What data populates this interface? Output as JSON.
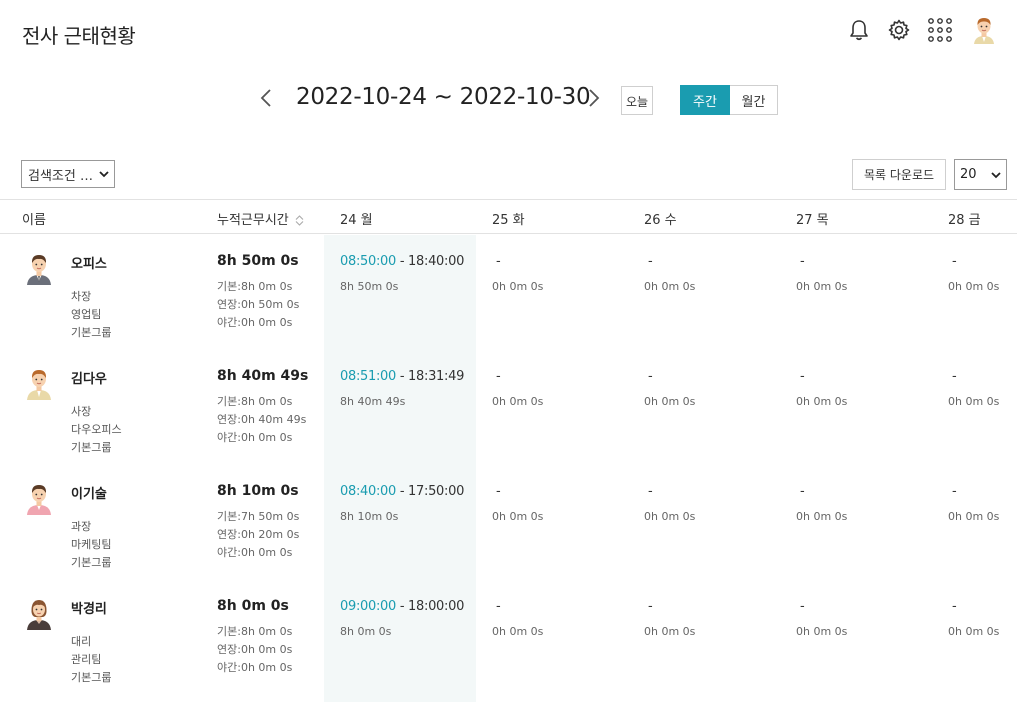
{
  "page": {
    "title": "전사 근태현황"
  },
  "header_icons": [
    "bell-icon",
    "gear-icon",
    "apps-grid-icon",
    "user-avatar"
  ],
  "date_nav": {
    "range": "2022-10-24 ~ 2022-10-30",
    "today_label": "오늘",
    "week_label": "주간",
    "month_label": "월간",
    "active_view": "주간"
  },
  "toolbar": {
    "filter_label": "검색조건 …",
    "download_label": "목록 다운로드",
    "page_size": "20"
  },
  "columns": {
    "name": "이름",
    "total": "누적근무시간",
    "days": [
      "24 월",
      "25 화",
      "26 수",
      "27 목",
      "28 금"
    ]
  },
  "colors": {
    "accent": "#1a9cb0",
    "highlight_bg": "#f3f8f8"
  },
  "employees": [
    {
      "name": "오피스",
      "title": "차장",
      "dept": "영업팀",
      "group": "기본그룹",
      "total": "8h 50m 0s",
      "basic": "기본:8h 0m 0s",
      "overtime": "연장:0h 50m 0s",
      "night": "야간:0h 0m 0s",
      "days": [
        {
          "in": "08:50:00",
          "out": " - 18:40:00",
          "duration": "8h 50m 0s"
        },
        {
          "in": "",
          "out": "-",
          "duration": "0h 0m 0s"
        },
        {
          "in": "",
          "out": "-",
          "duration": "0h 0m 0s"
        },
        {
          "in": "",
          "out": "-",
          "duration": "0h 0m 0s"
        },
        {
          "in": "",
          "out": "-",
          "duration": "0h 0m 0s"
        }
      ]
    },
    {
      "name": "김다우",
      "title": "사장",
      "dept": "다우오피스",
      "group": "기본그룹",
      "total": "8h 40m 49s",
      "basic": "기본:8h 0m 0s",
      "overtime": "연장:0h 40m 49s",
      "night": "야간:0h 0m 0s",
      "days": [
        {
          "in": "08:51:00",
          "out": " - 18:31:49",
          "duration": "8h 40m 49s"
        },
        {
          "in": "",
          "out": "-",
          "duration": "0h 0m 0s"
        },
        {
          "in": "",
          "out": "-",
          "duration": "0h 0m 0s"
        },
        {
          "in": "",
          "out": "-",
          "duration": "0h 0m 0s"
        },
        {
          "in": "",
          "out": "-",
          "duration": "0h 0m 0s"
        }
      ]
    },
    {
      "name": "이기술",
      "title": "과장",
      "dept": "마케팅팀",
      "group": "기본그룹",
      "total": "8h 10m 0s",
      "basic": "기본:7h 50m 0s",
      "overtime": "연장:0h 20m 0s",
      "night": "야간:0h 0m 0s",
      "days": [
        {
          "in": "08:40:00",
          "out": " - 17:50:00",
          "duration": "8h 10m 0s"
        },
        {
          "in": "",
          "out": "-",
          "duration": "0h 0m 0s"
        },
        {
          "in": "",
          "out": "-",
          "duration": "0h 0m 0s"
        },
        {
          "in": "",
          "out": "-",
          "duration": "0h 0m 0s"
        },
        {
          "in": "",
          "out": "-",
          "duration": "0h 0m 0s"
        }
      ]
    },
    {
      "name": "박경리",
      "title": "대리",
      "dept": "관리팀",
      "group": "기본그룹",
      "total": "8h 0m 0s",
      "basic": "기본:8h 0m 0s",
      "overtime": "연장:0h 0m 0s",
      "night": "야간:0h 0m 0s",
      "days": [
        {
          "in": "09:00:00",
          "out": " - 18:00:00",
          "duration": "8h 0m 0s"
        },
        {
          "in": "",
          "out": "-",
          "duration": "0h 0m 0s"
        },
        {
          "in": "",
          "out": "-",
          "duration": "0h 0m 0s"
        },
        {
          "in": "",
          "out": "-",
          "duration": "0h 0m 0s"
        },
        {
          "in": "",
          "out": "-",
          "duration": "0h 0m 0s"
        }
      ]
    }
  ]
}
